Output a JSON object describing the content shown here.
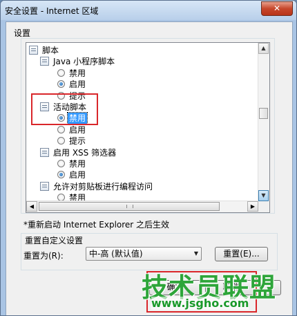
{
  "window": {
    "title": "安全设置 - Internet 区域",
    "close_label": "✕"
  },
  "settings": {
    "label": "设置",
    "tree": [
      {
        "kind": "category",
        "label": "脚本"
      },
      {
        "kind": "item",
        "label": "Java 小程序脚本"
      },
      {
        "kind": "radio",
        "label": "禁用",
        "checked": false
      },
      {
        "kind": "radio",
        "label": "启用",
        "checked": true
      },
      {
        "kind": "radio",
        "label": "提示",
        "checked": false
      },
      {
        "kind": "item",
        "label": "活动脚本"
      },
      {
        "kind": "radio",
        "label": "禁用",
        "checked": true,
        "selected": true
      },
      {
        "kind": "radio",
        "label": "启用",
        "checked": false
      },
      {
        "kind": "radio",
        "label": "提示",
        "checked": false
      },
      {
        "kind": "item",
        "label": "启用 XSS 筛选器"
      },
      {
        "kind": "radio",
        "label": "禁用",
        "checked": false
      },
      {
        "kind": "radio",
        "label": "启用",
        "checked": true
      },
      {
        "kind": "item",
        "label": "允许对剪贴板进行编程访问"
      },
      {
        "kind": "radio",
        "label": "禁用",
        "checked": false
      },
      {
        "kind": "radio",
        "label": "启用",
        "checked": false
      }
    ]
  },
  "note": "*重新启动 Internet Explorer 之后生效",
  "reset_group": {
    "title": "重置自定义设置",
    "reset_to_label": "重置为(R):",
    "combo_value": "中-高 (默认值)",
    "reset_button": "重置(E)..."
  },
  "buttons": {
    "ok": "确定",
    "cancel": "取消",
    "help": "?"
  },
  "watermark": {
    "main": "技术员联盟",
    "url": "www.jsgho.com"
  }
}
